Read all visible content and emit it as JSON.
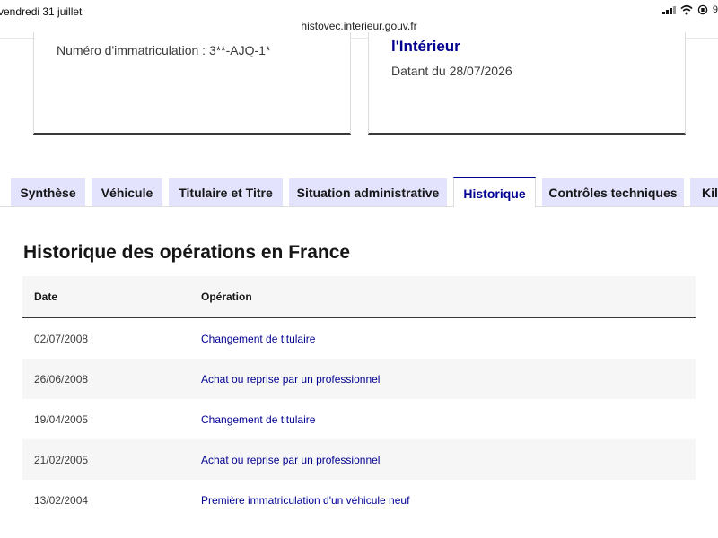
{
  "status_bar": {
    "time": "vendredi 31 juillet",
    "battery": "9"
  },
  "browser": {
    "url": "histovec.interieur.gouv.fr"
  },
  "cards": {
    "left": {
      "plate": "Numéro d'immatriculation : 3**-AJQ-1*"
    },
    "right": {
      "title_fragment": "l'Intérieur",
      "date": "Datant du 28/07/2026"
    }
  },
  "tabs": [
    {
      "label": "Synthèse",
      "active": false
    },
    {
      "label": "Véhicule",
      "active": false
    },
    {
      "label": "Titulaire et Titre",
      "active": false
    },
    {
      "label": "Situation administrative",
      "active": false
    },
    {
      "label": "Historique",
      "active": true
    },
    {
      "label": "Contrôles techniques",
      "active": false
    },
    {
      "label": "Kilo",
      "active": false
    }
  ],
  "history": {
    "title": "Historique des opérations en France",
    "headers": {
      "date": "Date",
      "operation": "Opération"
    },
    "rows": [
      {
        "date": "02/07/2008",
        "operation": "Changement de titulaire"
      },
      {
        "date": "26/06/2008",
        "operation": "Achat ou reprise par un professionnel"
      },
      {
        "date": "19/04/2005",
        "operation": "Changement de titulaire"
      },
      {
        "date": "21/02/2005",
        "operation": "Achat ou reprise par un professionnel"
      },
      {
        "date": "13/02/2004",
        "operation": "Première immatriculation d'un véhicule neuf"
      }
    ]
  },
  "colors": {
    "accent": "#000091",
    "tab_bg": "#e3e3fd",
    "row_alt": "#f6f6f6"
  }
}
